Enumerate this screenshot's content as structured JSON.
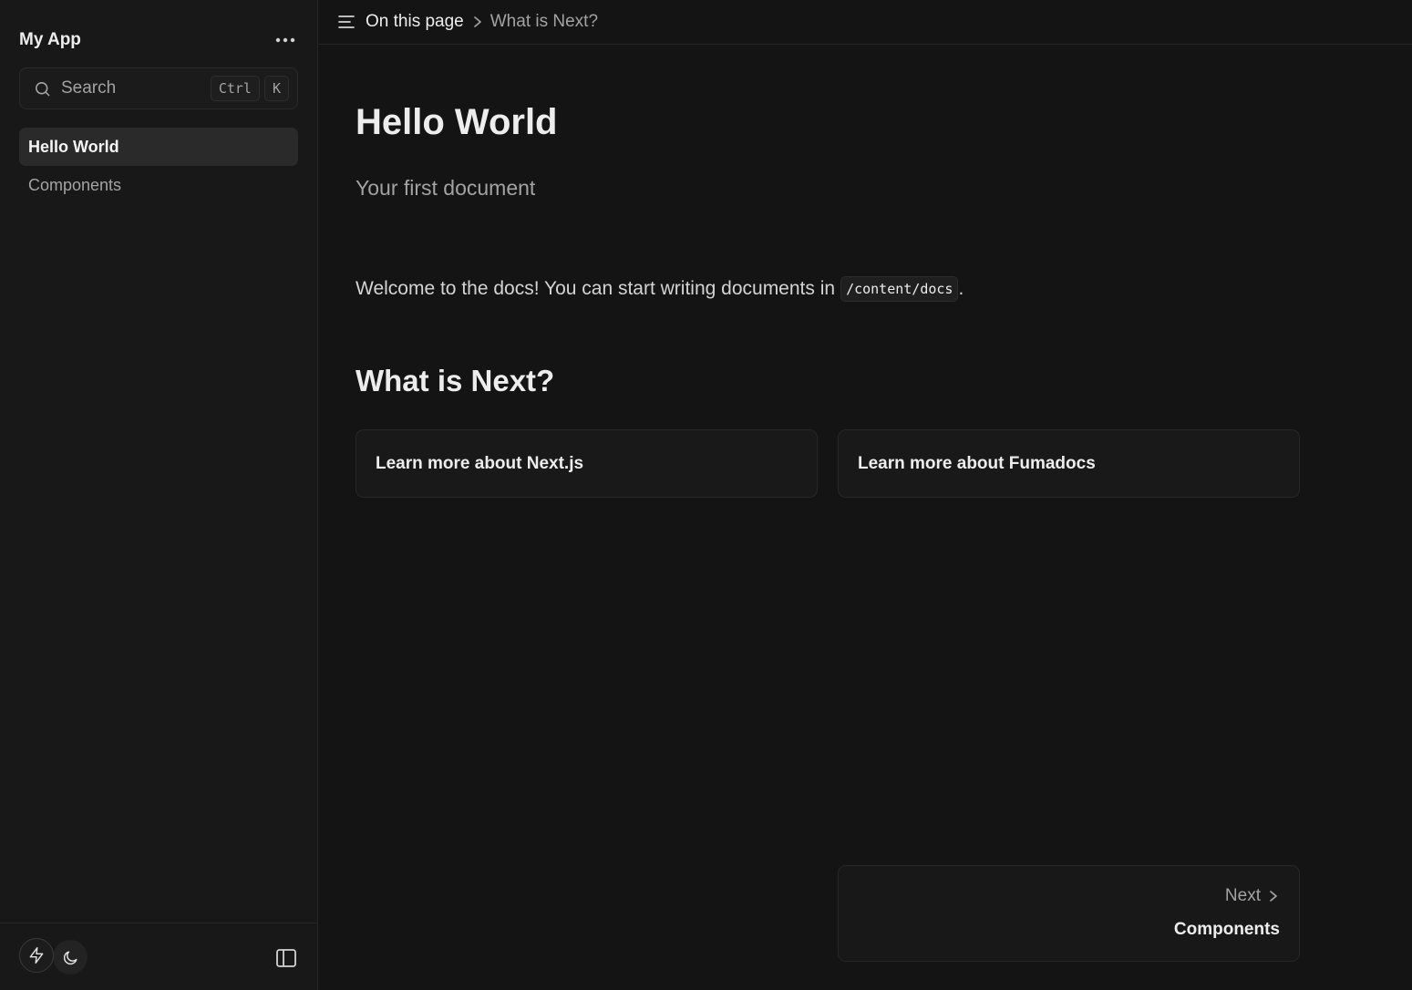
{
  "sidebar": {
    "app_name": "My App",
    "search": {
      "label": "Search",
      "shortcut_keys": [
        "Ctrl",
        "K"
      ]
    },
    "items": [
      {
        "label": "Hello World",
        "active": true
      },
      {
        "label": "Components",
        "active": false
      }
    ]
  },
  "topbar": {
    "toc_label": "On this page",
    "current_section": "What is Next?"
  },
  "page": {
    "title": "Hello World",
    "description": "Your first document",
    "intro_text": "Welcome to the docs! You can start writing documents in",
    "intro_code": "/content/docs",
    "intro_suffix": ".",
    "section_heading": "What is Next?",
    "cards": [
      {
        "label": "Learn more about Next.js"
      },
      {
        "label": "Learn more about Fumadocs"
      }
    ],
    "next": {
      "label": "Next",
      "title": "Components"
    }
  },
  "icons": {
    "more": "more-horizontal-icon",
    "search": "search-icon",
    "toc": "list-icon",
    "breadcrumb_sep": "chevron-right-icon",
    "theme_system": "bolt-icon",
    "theme_dark": "moon-icon",
    "sidebar_toggle": "sidebar-panel-icon"
  },
  "colors": {
    "background": "#141414",
    "sidebar_background": "#181818",
    "active_item_background": "#2a2a2a",
    "text_primary": "#ededed",
    "text_muted": "#a3a3a3"
  }
}
